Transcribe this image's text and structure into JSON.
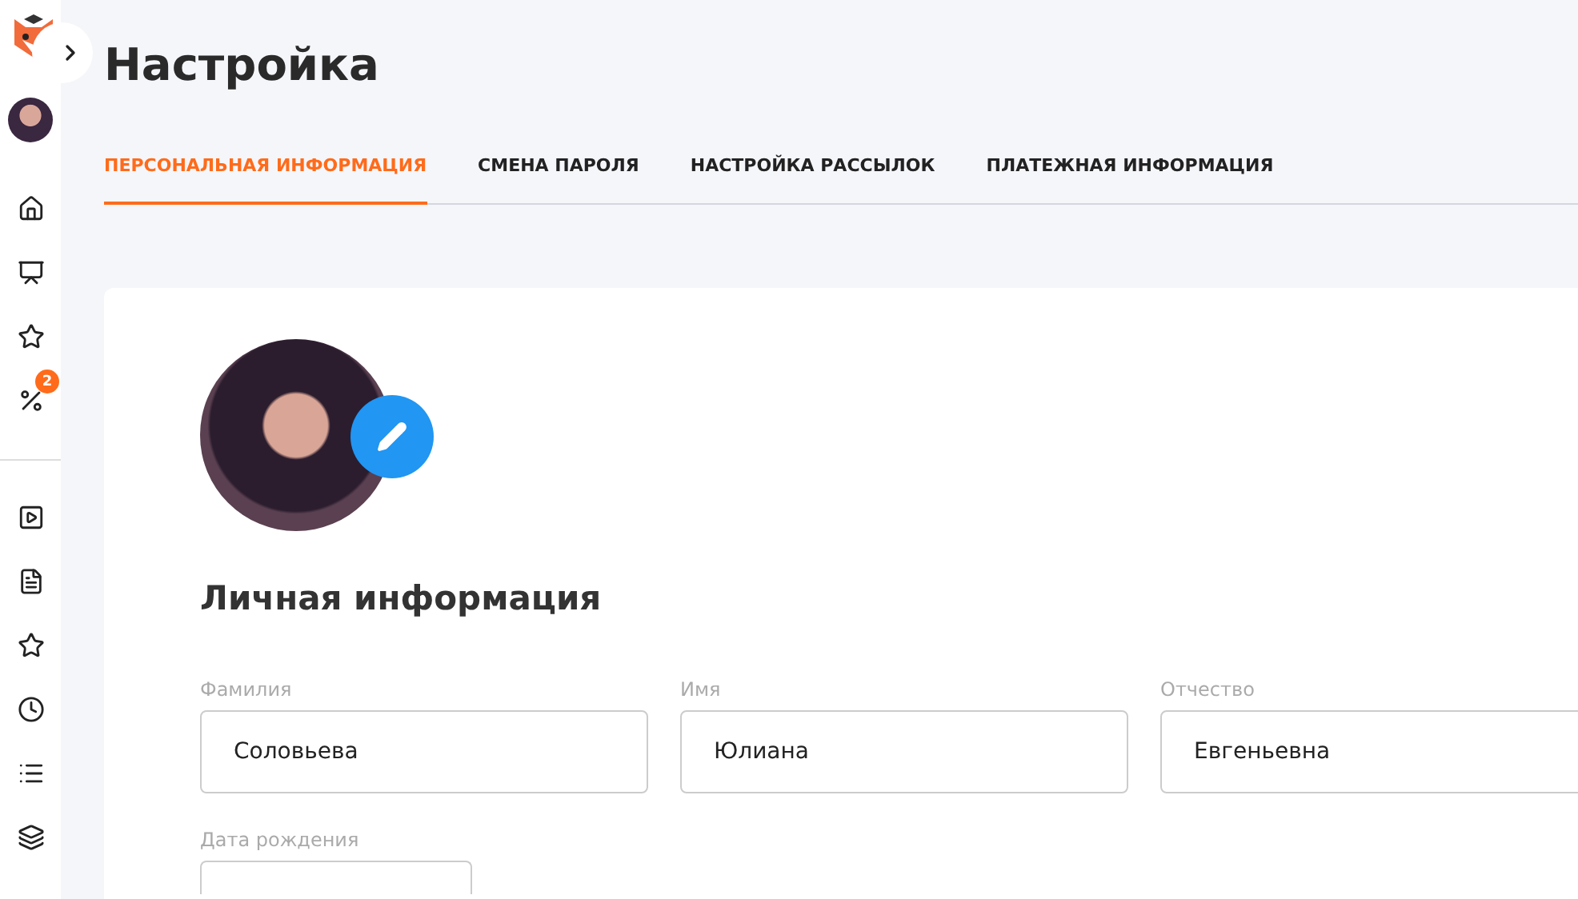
{
  "sidebar": {
    "groups": [
      [
        {
          "kind": "home"
        },
        {
          "kind": "presentation"
        },
        {
          "kind": "star"
        },
        {
          "kind": "percent",
          "badge": "2"
        }
      ],
      [
        {
          "kind": "play"
        },
        {
          "kind": "list-doc"
        },
        {
          "kind": "star"
        },
        {
          "kind": "clock"
        },
        {
          "kind": "list"
        },
        {
          "kind": "layers"
        }
      ]
    ]
  },
  "page": {
    "title": "Настройка"
  },
  "tabs": [
    {
      "label": "ПЕРСОНАЛЬНАЯ ИНФОРМАЦИЯ",
      "selected": true
    },
    {
      "label": "СМЕНА ПАРОЛЯ",
      "selected": false
    },
    {
      "label": "НАСТРОЙКА РАССЫЛОК",
      "selected": false
    },
    {
      "label": "ПЛАТЕЖНАЯ ИНФОРМАЦИЯ",
      "selected": false
    }
  ],
  "profile": {
    "heading": "Личная информация",
    "fields": [
      {
        "label": "Фамилия",
        "value": "Соловьева"
      },
      {
        "label": "Имя",
        "value": "Юлиана"
      },
      {
        "label": "Отчество",
        "value": "Евгеньевна"
      }
    ],
    "birth_label": "Дата рождения"
  }
}
